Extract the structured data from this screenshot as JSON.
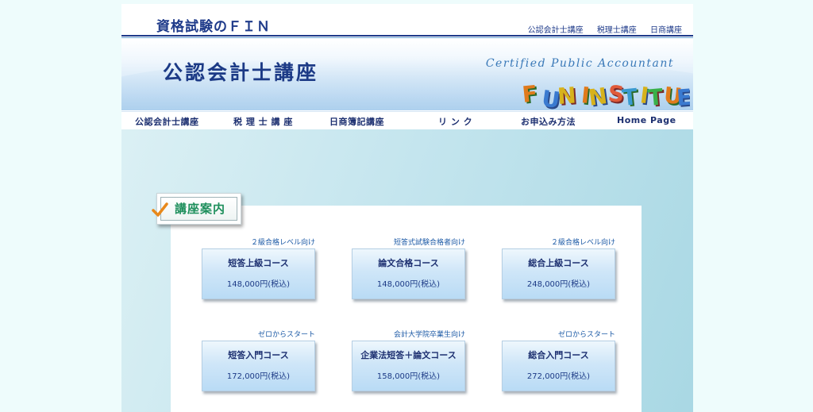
{
  "header": {
    "site_title": "資格試験のＦＩＮ",
    "top_links": [
      "公認会計士講座",
      "税理士講座",
      "日商講座"
    ]
  },
  "banner": {
    "title": "公認会計士講座",
    "subtitle": "Certified Public Accountant",
    "logo_text": "FUN INSTITUTE"
  },
  "nav": {
    "items": [
      "公認会計士講座",
      "税 理 士 講 座",
      "日商簿記講座",
      "リ ン ク",
      "お申込み方法",
      "Home Page"
    ]
  },
  "section": {
    "label": "講座案内"
  },
  "courses": [
    {
      "note": "２級合格レベル向け",
      "name": "短答上級コース",
      "price": "148,000円(税込)"
    },
    {
      "note": "短答式試験合格者向け",
      "name": "論文合格コース",
      "price": "148,000円(税込)"
    },
    {
      "note": "２級合格レベル向け",
      "name": "総合上級コース",
      "price": "248,000円(税込)"
    },
    {
      "note": "ゼロからスタート",
      "name": "短答入門コース",
      "price": "172,000円(税込)"
    },
    {
      "note": "会計大学院卒業生向け",
      "name": "企業法短答＋論文コース",
      "price": "158,000円(税込)"
    },
    {
      "note": "ゼロからスタート",
      "name": "総合入門コース",
      "price": "272,000円(税込)"
    }
  ],
  "colors": {
    "page_bg": "#eefcfc",
    "navy": "#1c2f70",
    "section_green": "#1e8f5c",
    "check_orange": "#e8881a"
  }
}
